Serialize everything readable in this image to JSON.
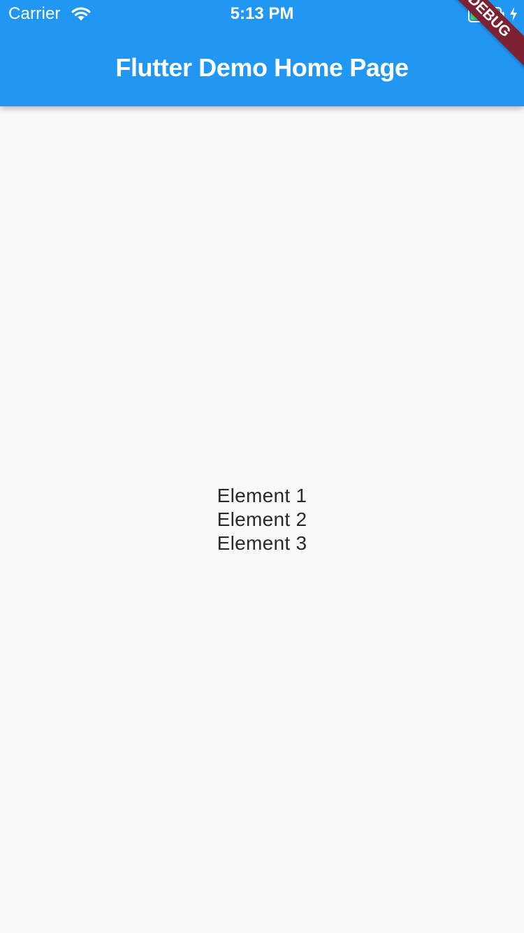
{
  "status_bar": {
    "carrier": "Carrier",
    "time": "5:13 PM",
    "wifi_icon": "wifi-icon",
    "battery_icon": "battery-icon",
    "charging_icon": "charging-bolt-icon",
    "battery_color": "#4cd964"
  },
  "app_bar": {
    "title": "Flutter Demo Home Page",
    "background_color": "#2196f3"
  },
  "debug_banner": {
    "label": "DEBUG",
    "color": "#7c2233"
  },
  "content": {
    "items": [
      {
        "label": "Element 1"
      },
      {
        "label": "Element 2"
      },
      {
        "label": "Element 3"
      }
    ],
    "background_color": "#faf8fb"
  }
}
